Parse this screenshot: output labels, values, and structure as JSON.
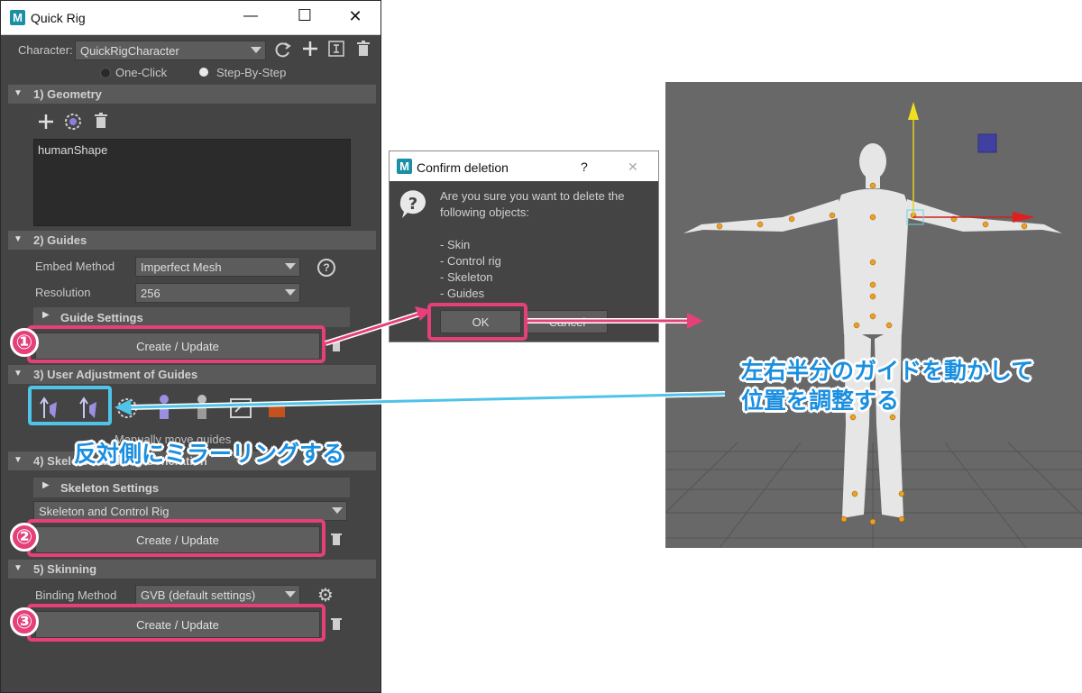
{
  "window": {
    "title": "Quick Rig",
    "character_label": "Character:",
    "character_value": "QuickRigCharacter",
    "mode_one_click": "One-Click",
    "mode_step": "Step-By-Step"
  },
  "sections": {
    "geometry": "1) Geometry",
    "guides": "2) Guides",
    "user_adjust": "3) User Adjustment of Guides",
    "skeleton": "4) Skeleton and Rig Generation",
    "skinning": "5) Skinning"
  },
  "geometry": {
    "items": [
      "humanShape"
    ]
  },
  "guides": {
    "embed_label": "Embed Method",
    "embed_value": "Imperfect Mesh",
    "resolution_label": "Resolution",
    "resolution_value": "256",
    "guide_settings": "Guide Settings",
    "create_update": "Create / Update"
  },
  "user_adjust": {
    "caption": "Manually move guides"
  },
  "skeleton": {
    "settings": "Skeleton Settings",
    "type_value": "Skeleton and Control Rig",
    "create_update": "Create / Update"
  },
  "skinning": {
    "binding_label": "Binding Method",
    "binding_value": "GVB (default settings)",
    "create_update": "Create / Update"
  },
  "dialog": {
    "title": "Confirm deletion",
    "help": "?",
    "close": "✕",
    "message_line1": "Are you sure you want to delete the",
    "message_line2": "following objects:",
    "items": [
      "- Skin",
      "- Control rig",
      "- Skeleton",
      "- Guides"
    ],
    "ok": "OK",
    "cancel": "Cancel"
  },
  "annotations": {
    "n1": "①",
    "n2": "②",
    "n3": "③",
    "mirror": "反対側にミラーリングする",
    "adjust_line1": "左右半分のガイドを動かして",
    "adjust_line2": "位置を調整する"
  },
  "colors": {
    "accent_pink": "#e5407a",
    "accent_cyan": "#4fc3e8",
    "annotation_blue": "#1a8fe0",
    "panel_bg": "#444444"
  }
}
